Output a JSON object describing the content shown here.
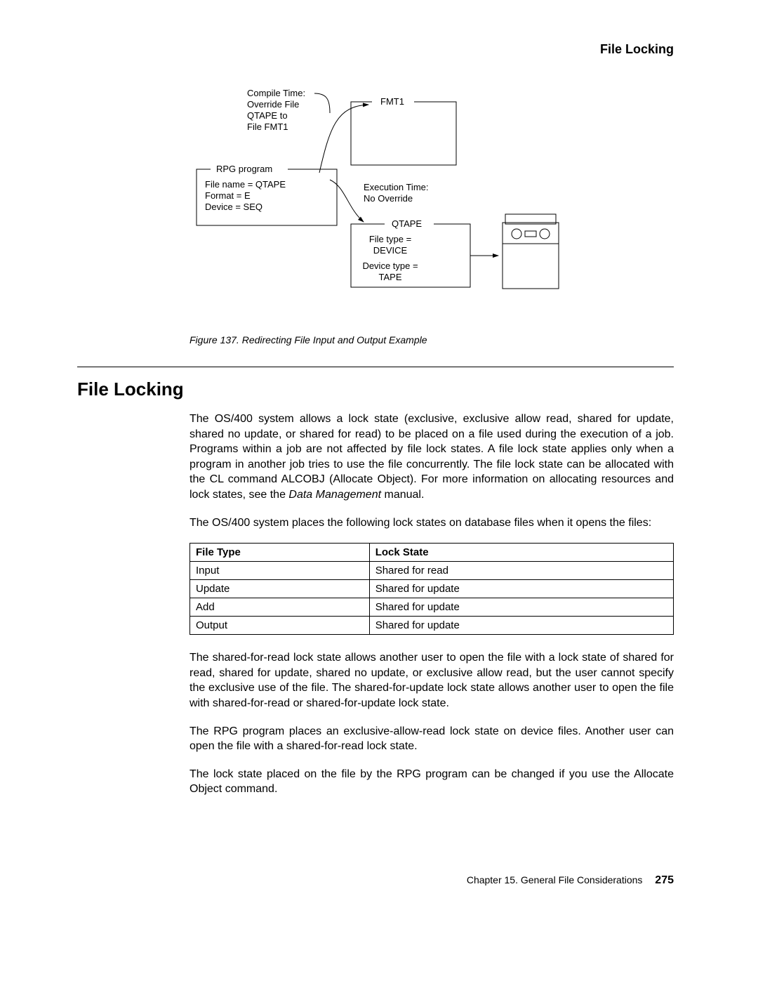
{
  "running_head": "File Locking",
  "figure": {
    "rpg_box_label": "RPG program",
    "rpg_box_l1": "File name = QTAPE",
    "rpg_box_l2": "Format = E",
    "rpg_box_l3": "Device = SEQ",
    "compile_l1": "Compile Time:",
    "compile_l2": "Override File",
    "compile_l3": "QTAPE to",
    "compile_l4": "File FMT1",
    "fmt1_label": "FMT1",
    "exec_l1": "Execution Time:",
    "exec_l2": "No Override",
    "qtape_label": "QTAPE",
    "qtape_l1": "File type =",
    "qtape_l2": "DEVICE",
    "qtape_l3": "Device type =",
    "qtape_l4": "TAPE"
  },
  "caption": "Figure 137. Redirecting File Input and Output Example",
  "section_title": "File Locking",
  "para1a": "The OS/400 system allows a lock state (exclusive, exclusive allow read, shared for update, shared no update, or shared for read) to be placed on a file used during the execution of a job. Programs within a job are not affected by file lock states. A file lock state applies only when a program in another job tries to use the file concurrently. The file lock state can be allocated with the CL command ALCOBJ (Allocate Object). For more information on allocating resources and lock states, see the ",
  "para1b": "Data Management",
  "para1c": " manual.",
  "para2": "The OS/400 system places the following lock states on database files when it opens the files:",
  "table": {
    "h1": "File Type",
    "h2": "Lock State",
    "rows": [
      [
        "Input",
        "Shared for read"
      ],
      [
        "Update",
        "Shared for update"
      ],
      [
        "Add",
        "Shared for update"
      ],
      [
        "Output",
        "Shared for update"
      ]
    ]
  },
  "para3": "The shared-for-read lock state allows another user to open the file with a lock state of shared for read, shared for update, shared no update, or exclusive allow read, but the user cannot specify the exclusive use of the file. The shared-for-update lock state allows another user to open the file with shared-for-read or shared-for-update lock state.",
  "para4": "The RPG program places an exclusive-allow-read lock state on device files. Another user can open the file with a shared-for-read lock state.",
  "para5": "The lock state placed on the file by the RPG program can be changed if you use the Allocate Object command.",
  "footer_chapter": "Chapter 15.  General File Considerations",
  "footer_page": "275"
}
